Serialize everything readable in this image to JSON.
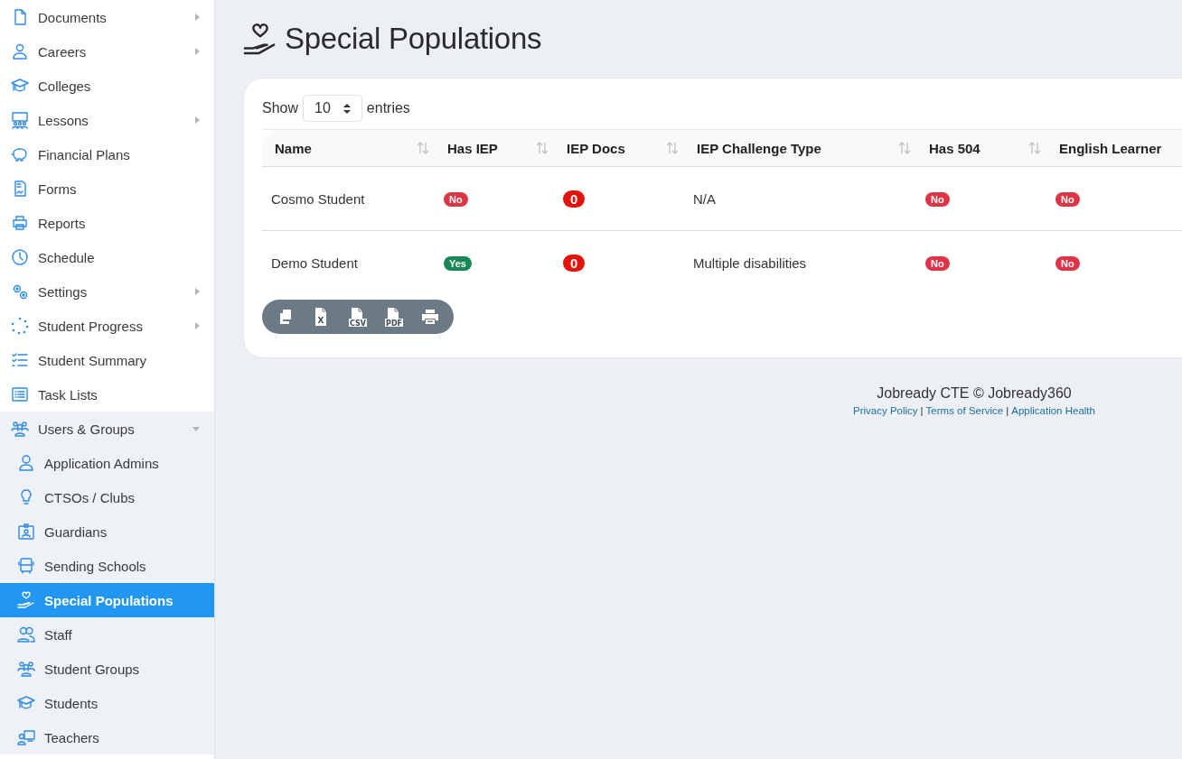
{
  "sidebar": {
    "items": [
      {
        "label": "Documents",
        "expandable": true,
        "expanded": false,
        "selected": false
      },
      {
        "label": "Careers",
        "expandable": true,
        "expanded": false,
        "selected": false
      },
      {
        "label": "Colleges",
        "expandable": false,
        "selected": false
      },
      {
        "label": "Lessons",
        "expandable": true,
        "expanded": false,
        "selected": false
      },
      {
        "label": "Financial Plans",
        "expandable": false,
        "selected": false
      },
      {
        "label": "Forms",
        "expandable": false,
        "selected": false
      },
      {
        "label": "Reports",
        "expandable": false,
        "selected": false
      },
      {
        "label": "Schedule",
        "expandable": false,
        "selected": false
      },
      {
        "label": "Settings",
        "expandable": true,
        "expanded": false,
        "selected": false
      },
      {
        "label": "Student Progress",
        "expandable": true,
        "expanded": false,
        "selected": false
      },
      {
        "label": "Student Summary",
        "expandable": false,
        "selected": false
      },
      {
        "label": "Task Lists",
        "expandable": false,
        "selected": false
      },
      {
        "label": "Users & Groups",
        "expandable": true,
        "expanded": true,
        "selected": false,
        "children": [
          {
            "label": "Application Admins",
            "selected": false
          },
          {
            "label": "CTSOs / Clubs",
            "selected": false
          },
          {
            "label": "Guardians",
            "selected": false
          },
          {
            "label": "Sending Schools",
            "selected": false
          },
          {
            "label": "Special Populations",
            "selected": true
          },
          {
            "label": "Staff",
            "selected": false
          },
          {
            "label": "Student Groups",
            "selected": false
          },
          {
            "label": "Students",
            "selected": false
          },
          {
            "label": "Teachers",
            "selected": false
          }
        ]
      }
    ]
  },
  "page": {
    "title": "Special Populations"
  },
  "table": {
    "show_label": "Show",
    "page_size": "10",
    "entries_label": "entries",
    "columns": [
      {
        "label": "Name",
        "sortable": true
      },
      {
        "label": "Has IEP",
        "sortable": true
      },
      {
        "label": "IEP Docs",
        "sortable": true
      },
      {
        "label": "IEP Challenge Type",
        "sortable": true
      },
      {
        "label": "Has 504",
        "sortable": true
      },
      {
        "label": "English Learner",
        "sortable": false
      }
    ],
    "rows": [
      {
        "name": "Cosmo Student",
        "has_iep": {
          "text": "No",
          "color": "#dc3545"
        },
        "iep_docs": "0",
        "iep_challenge_type": "N/A",
        "has_504": {
          "text": "No",
          "color": "#dc3545"
        },
        "english_learner": {
          "text": "No",
          "color": "#dc3545"
        }
      },
      {
        "name": "Demo Student",
        "has_iep": {
          "text": "Yes",
          "color": "#198754"
        },
        "iep_docs": "0",
        "iep_challenge_type": "Multiple disabilities",
        "has_504": {
          "text": "No",
          "color": "#dc3545"
        },
        "english_learner": {
          "text": "No",
          "color": "#dc3545"
        }
      }
    ],
    "export_buttons": [
      {
        "kind": "copy"
      },
      {
        "kind": "excel",
        "mark": "X"
      },
      {
        "kind": "csv",
        "mark": "CSV"
      },
      {
        "kind": "pdf",
        "mark": "PDF"
      },
      {
        "kind": "print"
      }
    ]
  },
  "footer": {
    "text": "Jobready CTE © Jobready360",
    "links": [
      {
        "kind": "link",
        "text": "Privacy Policy"
      },
      {
        "kind": "separator",
        "text": "|"
      },
      {
        "kind": "link",
        "text": "Terms of Service"
      },
      {
        "kind": "separator",
        "text": "|"
      },
      {
        "kind": "link",
        "text": "Application Health"
      }
    ]
  }
}
